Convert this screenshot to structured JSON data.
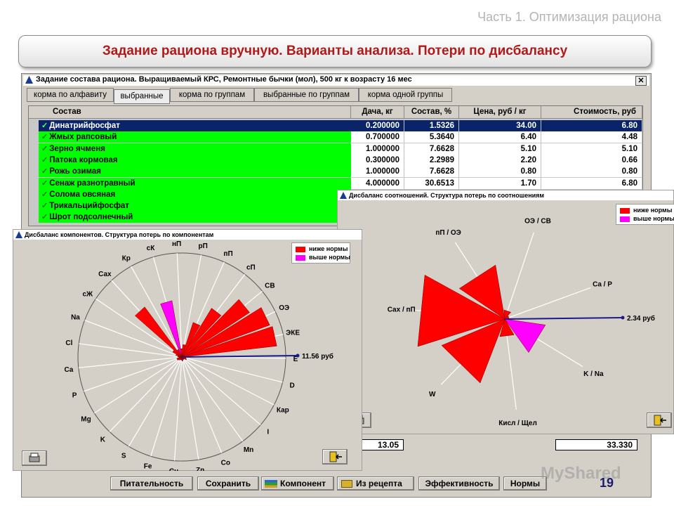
{
  "slide": {
    "subtitle": "Часть 1. Оптимизация рациона",
    "title": "Задание рациона вручную. Варианты анализа. Потери по дисбалансу",
    "page_number": "19",
    "watermark": "MyShared"
  },
  "main_window": {
    "title": "Задание состава рациона. Выращиваемый КРС, Ремонтные бычки (мол), 500 кг к возрасту 16 мес",
    "close": "✕",
    "tabs": [
      {
        "label": "корма по алфавиту",
        "active": false
      },
      {
        "label": "выбранные",
        "active": true
      },
      {
        "label": "корма по группам",
        "active": false
      },
      {
        "label": "выбранные по группам",
        "active": false
      },
      {
        "label": "корма одной группы",
        "active": false
      }
    ],
    "columns": [
      "Состав",
      "Дача, кг",
      "Состав, %",
      "Цена, руб / кг",
      "Стоимость, руб"
    ],
    "rows": [
      {
        "name": "Динатрийфосфат",
        "dacha": "0.200000",
        "sostav": "1.5326",
        "price": "34.00",
        "cost": "6.80",
        "selected": true
      },
      {
        "name": "Жмых рапсовый",
        "dacha": "0.700000",
        "sostav": "5.3640",
        "price": "6.40",
        "cost": "4.48"
      },
      {
        "name": "Зерно ячменя",
        "dacha": "1.000000",
        "sostav": "7.6628",
        "price": "5.10",
        "cost": "5.10"
      },
      {
        "name": "Патока кормовая",
        "dacha": "0.300000",
        "sostav": "2.2989",
        "price": "2.20",
        "cost": "0.66"
      },
      {
        "name": "Рожь озимая",
        "dacha": "1.000000",
        "sostav": "7.6628",
        "price": "0.80",
        "cost": "0.80"
      },
      {
        "name": "Сенаж разнотравный",
        "dacha": "4.000000",
        "sostav": "30.6513",
        "price": "1.70",
        "cost": "6.80"
      },
      {
        "name": "Солома овсяная"
      },
      {
        "name": "Трикальцийфосфат"
      },
      {
        "name": "Шрот подсолнечный"
      }
    ],
    "totals": {
      "dacha_total": "13.05",
      "cost_total": "33.330"
    },
    "buttons": [
      "Питательность",
      "Сохранить",
      "Компонент",
      "Из рецепта",
      "Эффективность",
      "Нормы"
    ]
  },
  "components_popup": {
    "title": "Дисбаланс компонентов. Структура потерь по компонентам",
    "legend": [
      {
        "label": "ниже нормы",
        "color": "#ff0000"
      },
      {
        "label": "выше нормы",
        "color": "#ff00ff"
      }
    ],
    "axis_labels": [
      "ЭКЕ",
      "ОЭ",
      "СВ",
      "сП",
      "пП",
      "рП",
      "нП",
      "сК",
      "Кр",
      "Сах",
      "сЖ",
      "Na",
      "Cl",
      "Ca",
      "P",
      "Mg",
      "K",
      "S",
      "Fe",
      "Cu",
      "Zn",
      "Co",
      "Mn",
      "I",
      "Кар",
      "D",
      "E"
    ],
    "value_label": "11.56 руб",
    "below_norm_values": [
      0.92,
      0.9,
      0.78,
      0.55,
      0.35,
      0.12,
      0.08,
      0.25,
      0.08,
      0.6,
      0.1,
      0.06,
      0.04,
      0.03,
      0.05,
      0.05,
      0.04,
      0.03,
      0.03,
      0.03,
      0.04,
      0.03,
      0.03,
      0.03,
      0.05,
      0.04,
      0.05
    ],
    "above_norm_values": [
      0,
      0,
      0,
      0,
      0,
      0,
      0,
      0.55,
      0,
      0,
      0,
      0,
      0,
      0,
      0,
      0,
      0,
      0,
      0,
      0,
      0,
      0,
      0,
      0,
      0,
      0,
      0
    ]
  },
  "ratios_popup": {
    "title": "Дисбаланс соотношений. Структура потерь по соотношениям",
    "legend": [
      {
        "label": "ниже нормы",
        "color": "#ff0000"
      },
      {
        "label": "выше нормы",
        "color": "#ff00ff"
      }
    ],
    "axis_labels": [
      "Ca / P",
      "ОЭ / СВ",
      "пП / ОЭ",
      "Сах / пП",
      "W",
      "Кисл / Щел",
      "K / Na"
    ],
    "value_label": "2.34 руб",
    "below_norm_values": [
      0.05,
      0.1,
      0.6,
      1.0,
      0.75,
      0.2,
      0.05
    ],
    "above_norm_values": [
      0,
      0,
      0,
      0,
      0,
      0,
      0.45
    ]
  }
}
